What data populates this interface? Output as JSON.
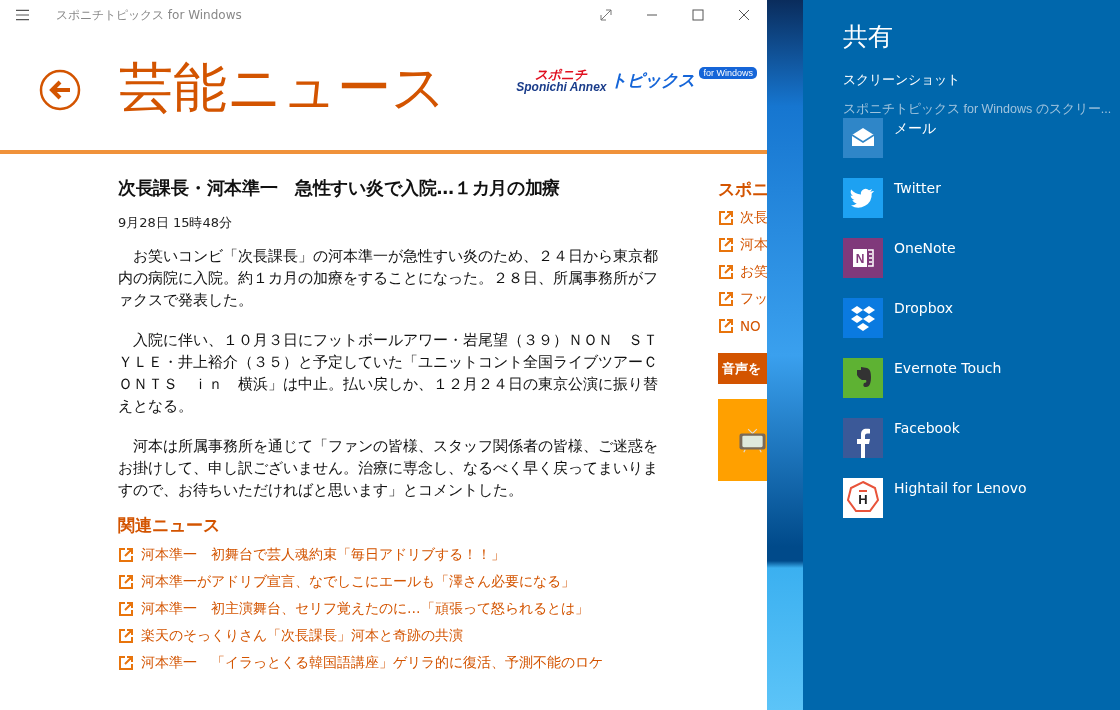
{
  "window": {
    "title": "スポニチトピックス for Windows"
  },
  "header": {
    "title": "芸能ニュース",
    "logo": {
      "top": "スポニチ",
      "main": "Sponichi Annex",
      "sub": "トピックス",
      "badge": "for Windows"
    }
  },
  "article": {
    "headline": "次長課長・河本準一　急性すい炎で入院…１カ月の加療",
    "date": "9月28日 15時48分",
    "paragraphs": [
      "　お笑いコンビ「次長課長」の河本準一が急性すい炎のため、２４日から東京都内の病院に入院。約１カ月の加療をすることになった。２８日、所属事務所がファクスで発表した。",
      "　入院に伴い、１０月３日にフットボールアワー・岩尾望（３９）ＮＯＮ　ＳＴＹＬＥ・井上裕介（３５）と予定していた「ユニットコント全国ライブツアーＣＯＮＴＳ　ｉｎ　横浜」は中止。払い戻しか、１２月２４日の東京公演に振り替えとなる。",
      "　河本は所属事務所を通じて「ファンの皆様、スタッフ関係者の皆様、ご迷惑をお掛けして、申し訳ございません。治療に専念し、なるべく早く戻ってまいりますので、お待ちいただければと思います」とコメントした。"
    ]
  },
  "related": {
    "heading": "関連ニュース",
    "links": [
      "河本準一　初舞台で芸人魂約束「毎日アドリブする！！」",
      "河本準一がアドリブ宣言、なでしこにエールも「澤さん必要になる」",
      "河本準一　初主演舞台、セリフ覚えたのに…「頑張って怒られるとは」",
      "楽天のそっくりさん「次長課長」河本と奇跡の共演",
      "河本準一　「イラっとくる韓国語講座」ゲリラ的に復活、予測不能のロケ"
    ]
  },
  "side": {
    "heading": "スポニ",
    "links": [
      "次長",
      "河本",
      "お笑",
      "フッ",
      "NO"
    ],
    "banner": "音声を"
  },
  "share": {
    "title": "共有",
    "subtitle": "スクリーンショット",
    "description": "スポニチトピックス for Windows のスクリー...",
    "apps": [
      {
        "name": "メール",
        "kind": "mail",
        "color": "#2f86c8"
      },
      {
        "name": "Twitter",
        "kind": "twitter",
        "color": "#1da1f2"
      },
      {
        "name": "OneNote",
        "kind": "onenote",
        "color": "#80397b",
        "glyph": "N"
      },
      {
        "name": "Dropbox",
        "kind": "dropbox",
        "color": "#0a7ae0"
      },
      {
        "name": "Evernote Touch",
        "kind": "evernote",
        "color": "#5eb233"
      },
      {
        "name": "Facebook",
        "kind": "facebook",
        "color": "#3b5998"
      },
      {
        "name": "Hightail for Lenovo",
        "kind": "hightail",
        "color": "#ffffff",
        "glyph": "H"
      }
    ]
  }
}
